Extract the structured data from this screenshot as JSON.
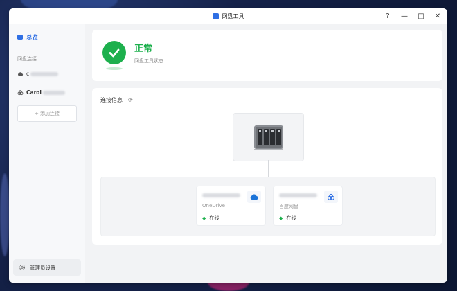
{
  "window": {
    "title": "网盘工具",
    "help_label": "?"
  },
  "sidebar": {
    "overview_label": "总览",
    "section_label": "网盘连接",
    "connections": [
      {
        "label": "c"
      },
      {
        "label": "Carol"
      }
    ],
    "add_label": "+  添加连接",
    "admin_label": "管理员设置"
  },
  "status": {
    "title": "正常",
    "subtitle": "网盘工具状态",
    "color": "#1db04d"
  },
  "info": {
    "title": "连接信息",
    "drives": [
      {
        "kind": "OneDrive",
        "status": "在线",
        "icon": "onedrive-cloud-icon"
      },
      {
        "kind": "百度网盘",
        "status": "在线",
        "icon": "baidu-pan-icon"
      }
    ]
  },
  "colors": {
    "accent": "#2f6fe4",
    "online": "#1db04d"
  }
}
